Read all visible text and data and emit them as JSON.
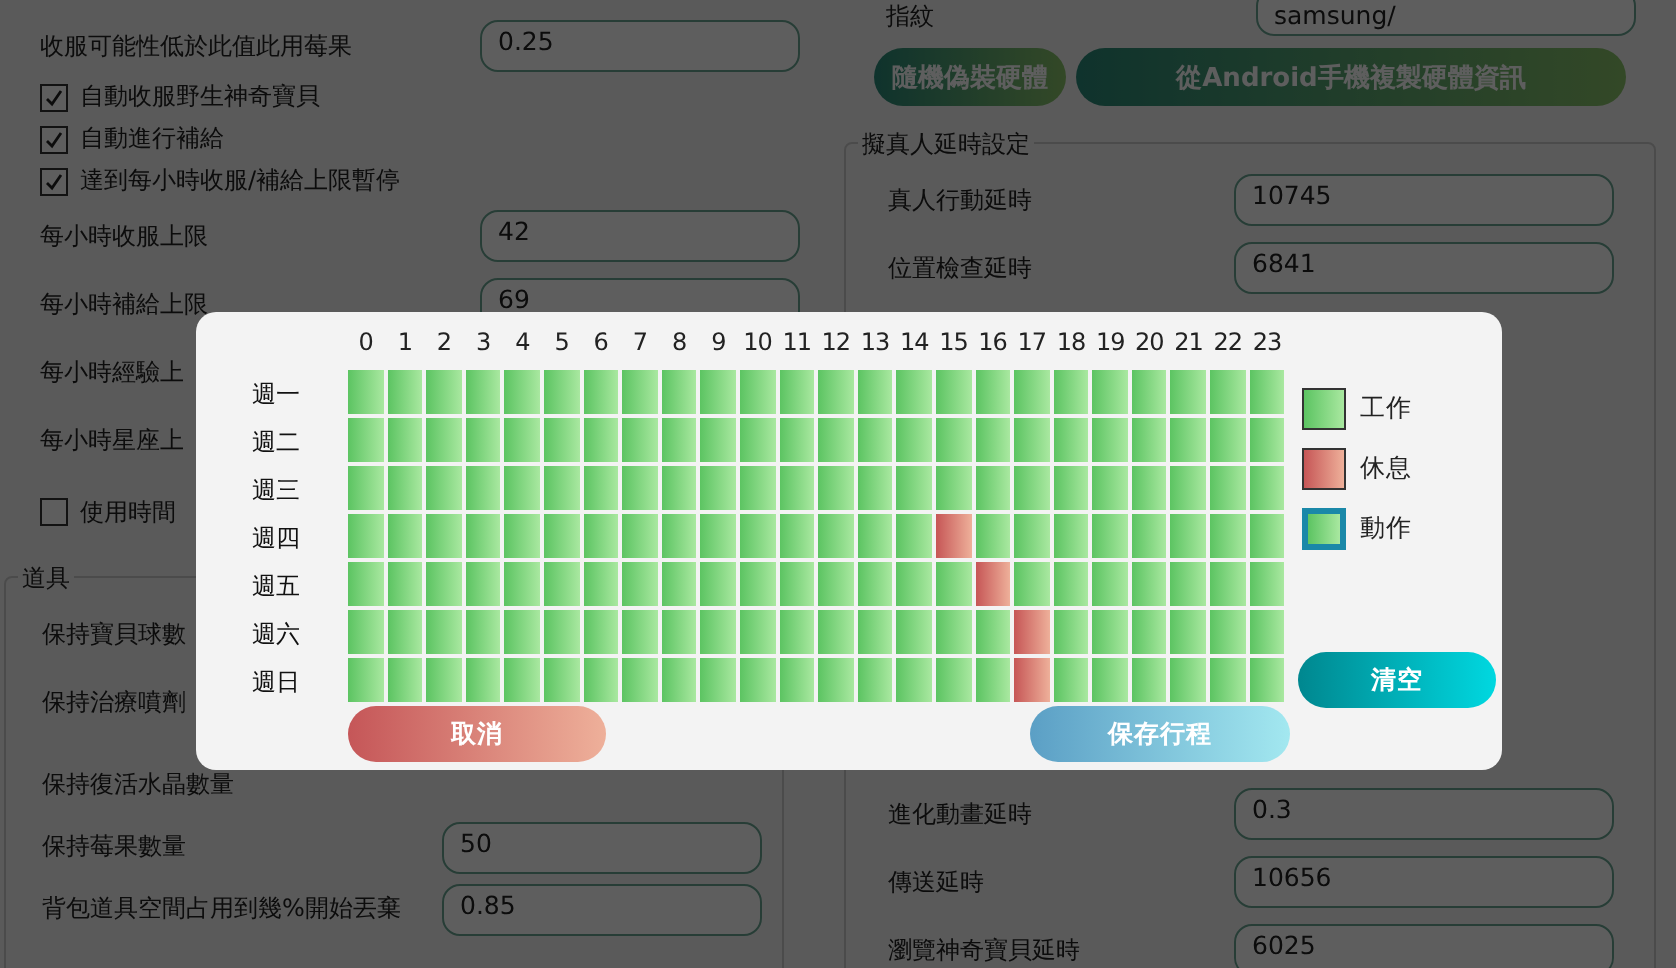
{
  "left_settings": {
    "top_field": {
      "label": "收服可能性低於此值此用莓果",
      "value": "0.25"
    },
    "checkboxes": [
      {
        "label": "自動收服野生神奇寶貝",
        "checked": true
      },
      {
        "label": "自動進行補給",
        "checked": true
      },
      {
        "label": "達到每小時收服/補給上限暫停",
        "checked": true
      }
    ],
    "limit_fields": [
      {
        "label": "每小時收服上限",
        "value": "42"
      },
      {
        "label": "每小時補給上限",
        "value": "69"
      },
      {
        "label": "每小時經驗上"
      },
      {
        "label": "每小時星座上"
      }
    ],
    "schedule_checkbox": {
      "label": "使用時間",
      "checked": false
    }
  },
  "items_group": {
    "title": "道具",
    "rows": [
      {
        "label": "保持寶貝球數"
      },
      {
        "label": "保持治療噴劑"
      },
      {
        "label": "保持復活水晶數量"
      },
      {
        "label": "保持莓果數量",
        "value": "50"
      },
      {
        "label": "背包道具空間占用到幾%開始丟棄",
        "value": "0.85"
      }
    ]
  },
  "device": {
    "fingerprint_label": "指紋",
    "fingerprint_value": "samsung/",
    "buttons": [
      "隨機偽裝硬體",
      "從Android手機複製硬體資訊"
    ]
  },
  "delay_group": {
    "title": "擬真人延時設定",
    "top_rows": [
      {
        "label": "真人行動延時",
        "value": "10745"
      },
      {
        "label": "位置檢查延時",
        "value": "6841"
      }
    ],
    "bottom_rows": [
      {
        "label": "進化動畫延時",
        "value": "0.3"
      },
      {
        "label": "傳送延時",
        "value": "10656"
      },
      {
        "label": "瀏覽神奇寶貝延時",
        "value": "6025"
      }
    ]
  },
  "schedule_dialog": {
    "hours": [
      "0",
      "1",
      "2",
      "3",
      "4",
      "5",
      "6",
      "7",
      "8",
      "9",
      "10",
      "11",
      "12",
      "13",
      "14",
      "15",
      "16",
      "17",
      "18",
      "19",
      "20",
      "21",
      "22",
      "23"
    ],
    "days": [
      {
        "label": "週一",
        "rest": [
          false,
          false,
          false,
          false,
          false,
          false,
          false,
          false,
          false,
          false,
          false,
          false,
          false,
          false,
          false,
          false,
          false,
          false,
          false,
          false,
          false,
          false,
          false,
          false
        ]
      },
      {
        "label": "週二",
        "rest": [
          false,
          false,
          false,
          false,
          false,
          false,
          false,
          false,
          false,
          false,
          false,
          false,
          false,
          false,
          false,
          false,
          false,
          false,
          false,
          false,
          false,
          false,
          false,
          false
        ]
      },
      {
        "label": "週三",
        "rest": [
          false,
          false,
          false,
          false,
          false,
          false,
          false,
          false,
          false,
          false,
          false,
          false,
          false,
          false,
          false,
          false,
          false,
          false,
          false,
          false,
          false,
          false,
          false,
          false
        ]
      },
      {
        "label": "週四",
        "rest": [
          false,
          false,
          false,
          false,
          false,
          false,
          false,
          false,
          false,
          false,
          false,
          false,
          false,
          false,
          false,
          true,
          false,
          false,
          false,
          false,
          false,
          false,
          false,
          false
        ]
      },
      {
        "label": "週五",
        "rest": [
          false,
          false,
          false,
          false,
          false,
          false,
          false,
          false,
          false,
          false,
          false,
          false,
          false,
          false,
          false,
          false,
          true,
          false,
          false,
          false,
          false,
          false,
          false,
          false
        ]
      },
      {
        "label": "週六",
        "rest": [
          false,
          false,
          false,
          false,
          false,
          false,
          false,
          false,
          false,
          false,
          false,
          false,
          false,
          false,
          false,
          false,
          false,
          true,
          false,
          false,
          false,
          false,
          false,
          false
        ]
      },
      {
        "label": "週日",
        "rest": [
          false,
          false,
          false,
          false,
          false,
          false,
          false,
          false,
          false,
          false,
          false,
          false,
          false,
          false,
          false,
          false,
          false,
          true,
          false,
          false,
          false,
          false,
          false,
          false
        ]
      }
    ],
    "legend": [
      {
        "kind": "work",
        "label": "工作"
      },
      {
        "kind": "rest",
        "label": "休息"
      },
      {
        "kind": "action",
        "label": "動作"
      }
    ],
    "cancel_button": "取消",
    "save_button": "保存行程",
    "clear_button": "清空"
  }
}
